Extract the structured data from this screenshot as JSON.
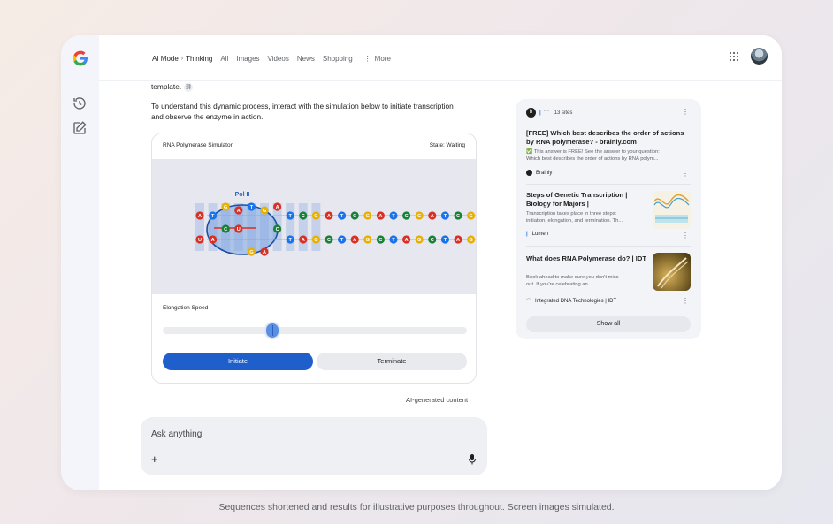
{
  "nav": {
    "breadcrumb_mode": "AI Mode",
    "breadcrumb_sep": "›",
    "breadcrumb_current": "Thinking",
    "tabs": [
      "All",
      "Images",
      "Videos",
      "News",
      "Shopping"
    ],
    "more_label": "More",
    "more_glyph": "⋮"
  },
  "content": {
    "fragment": "template.",
    "intro": "To understand this dynamic process, interact with the simulation below to initiate transcription and observe the enzyme in action."
  },
  "simulator": {
    "title": "RNA Polymerase Simulator",
    "state": "State: Waiting",
    "enzyme_label": "Pol II",
    "speed_label": "Elongation Speed",
    "speed_level": 0.36,
    "initiate_label": "Initiate",
    "terminate_label": "Terminate",
    "top_strand": [
      "A",
      "T",
      "G",
      "A",
      "T",
      "G",
      "A",
      "T",
      "C",
      "G",
      "A",
      "T",
      "C",
      "G",
      "A",
      "T",
      "C",
      "G",
      "A",
      "T",
      "C",
      "G",
      "A",
      "T"
    ],
    "bottom_strand": [
      "U",
      "A",
      "C",
      "U",
      "G",
      "A",
      "C",
      "T",
      "A",
      "G",
      "C",
      "T",
      "A",
      "G",
      "C",
      "T",
      "A",
      "G",
      "C",
      "T",
      "A",
      "G",
      "C",
      "T"
    ],
    "colors": {
      "A": "#d93025",
      "T": "#1a73e8",
      "G": "#e8b100",
      "C": "#188038",
      "U": "#d93025"
    }
  },
  "ai_note": "AI-generated content",
  "ask": {
    "placeholder": "Ask anything",
    "plus": "+"
  },
  "sources": {
    "count_label": "13 sites",
    "kebab": "⋮",
    "cards": [
      {
        "title": "[FREE] Which best describes the order of actions by RNA polymerase? - brainly.com",
        "snippet1": "✅ This answer is FREE! See the answer to your question:",
        "snippet2": "Which best describes the order of actions by RNA polym...",
        "source": "Brainly"
      },
      {
        "title": "Steps of Genetic Transcription | Biology for Majors |",
        "snippet1": "Transcription takes place in three steps:",
        "snippet2": "initiation, elongation, and termination. Th...",
        "source": "Lumen"
      },
      {
        "title": "What does RNA Polymerase do? | IDT",
        "snippet1": "Book ahead to make sure you don't miss",
        "snippet2": "out. If you're celebrating an...",
        "source": "Integrated DNA Technologies | IDT"
      }
    ],
    "show_all": "Show all"
  },
  "footer": "Sequences shortened and results for illustrative purposes throughout. Screen images simulated."
}
